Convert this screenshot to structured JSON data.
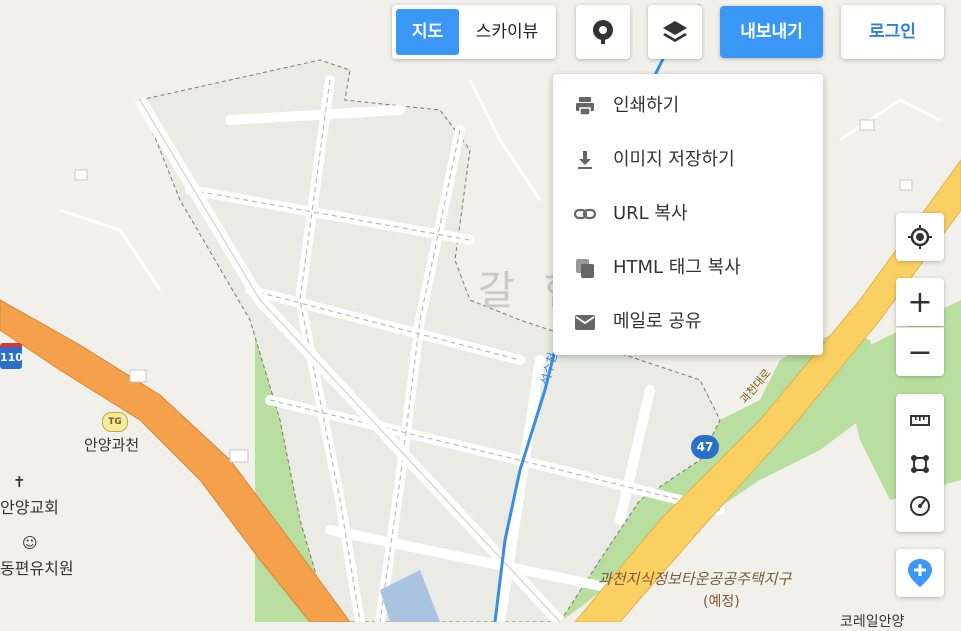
{
  "toolbar": {
    "map_type": {
      "selected": "지도",
      "options": [
        "지도",
        "스카이뷰"
      ]
    },
    "roadview_icon": "roadview-pin-icon",
    "layers_icon": "layers-icon",
    "export_label": "내보내기",
    "login_label": "로그인"
  },
  "export_menu": {
    "items": [
      {
        "label": "인쇄하기",
        "icon": "print-icon"
      },
      {
        "label": "이미지 저장하기",
        "icon": "download-icon"
      },
      {
        "label": "URL 복사",
        "icon": "link-icon"
      },
      {
        "label": "HTML 태그 복사",
        "icon": "copy-icon"
      },
      {
        "label": "메일로 공유",
        "icon": "mail-icon"
      }
    ]
  },
  "controls": {
    "locate_icon": "current-location-icon",
    "zoom_in": "+",
    "zoom_out": "−",
    "tools": [
      "ruler-icon",
      "area-icon",
      "radius-icon"
    ],
    "add_place_icon": "add-place-icon"
  },
  "map_labels": {
    "district": "갈 현",
    "river": "석수천",
    "road_label": "과천대로",
    "highway_shield_left": "110",
    "highway_shield_47": "47",
    "tg_badge": "TG",
    "tollgate": "안양과천",
    "church": "안양교회",
    "kindergarten": "동편유치원",
    "project": "과천지식정보타운공공주택지구",
    "project_sub": "(예정)",
    "bottom_right_partial": "코레일안양"
  },
  "colors": {
    "accent": "#3a97f5",
    "highway": "#f5a04a",
    "road_yellow": "#fbd063",
    "park": "#b9dfa0",
    "land": "#f2f0ea"
  }
}
